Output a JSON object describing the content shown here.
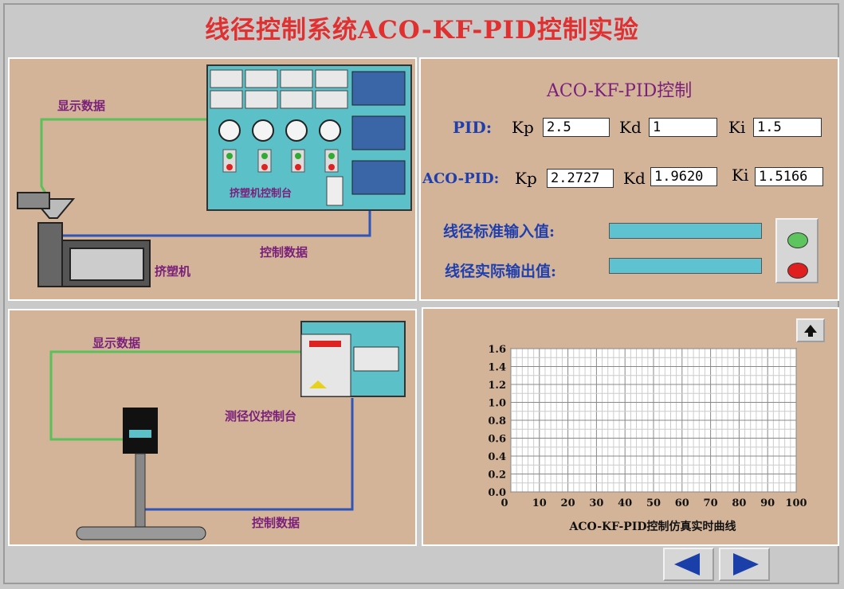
{
  "title": "线径控制系统ACO-KF-PID控制实验",
  "extruder_panel": {
    "display_data": "显示数据",
    "control_data": "控制数据",
    "console_label": "挤塑机控制台",
    "extruder_label": "挤塑机"
  },
  "control_panel": {
    "heading": "ACO-KF-PID控制",
    "pid_label": "PID:",
    "aco_pid_label": "ACO-PID:",
    "kp_label": "Kp",
    "kd_label": "Kd",
    "ki_label": "Ki",
    "pid_kp": "2.5",
    "pid_kd": "1",
    "pid_ki": "1.5",
    "aco_kp": "2.2727",
    "aco_kd": "1.9620",
    "aco_ki": "1.5166",
    "std_input_label": "线径标准输入值:",
    "actual_output_label": "线径实际输出值:"
  },
  "gauge_panel": {
    "display_data": "显示数据",
    "control_data": "控制数据",
    "console_label": "测径仪控制台"
  },
  "chart_data": {
    "type": "line",
    "xlabel": "ACO-KF-PID控制仿真实时曲线",
    "ylabel": "",
    "xlim": [
      0,
      100
    ],
    "ylim": [
      0,
      1.6
    ],
    "x_ticks": [
      "0",
      "10",
      "20",
      "30",
      "40",
      "50",
      "60",
      "70",
      "80",
      "90",
      "100"
    ],
    "y_ticks": [
      "1.6",
      "1.4",
      "1.2",
      "1.0",
      "0.8",
      "0.6",
      "0.4",
      "0.2",
      "0.0"
    ],
    "grid": true,
    "series": []
  },
  "colors": {
    "title": "#e03030",
    "panel_bg": "#d4b499",
    "console_bg": "#5bc0c8",
    "green_wire": "#5ac05a",
    "blue_wire": "#2e55b8"
  },
  "icons": {
    "scroll_up": "up-arrow-icon",
    "prev": "left-arrow-icon",
    "next": "right-arrow-icon"
  }
}
